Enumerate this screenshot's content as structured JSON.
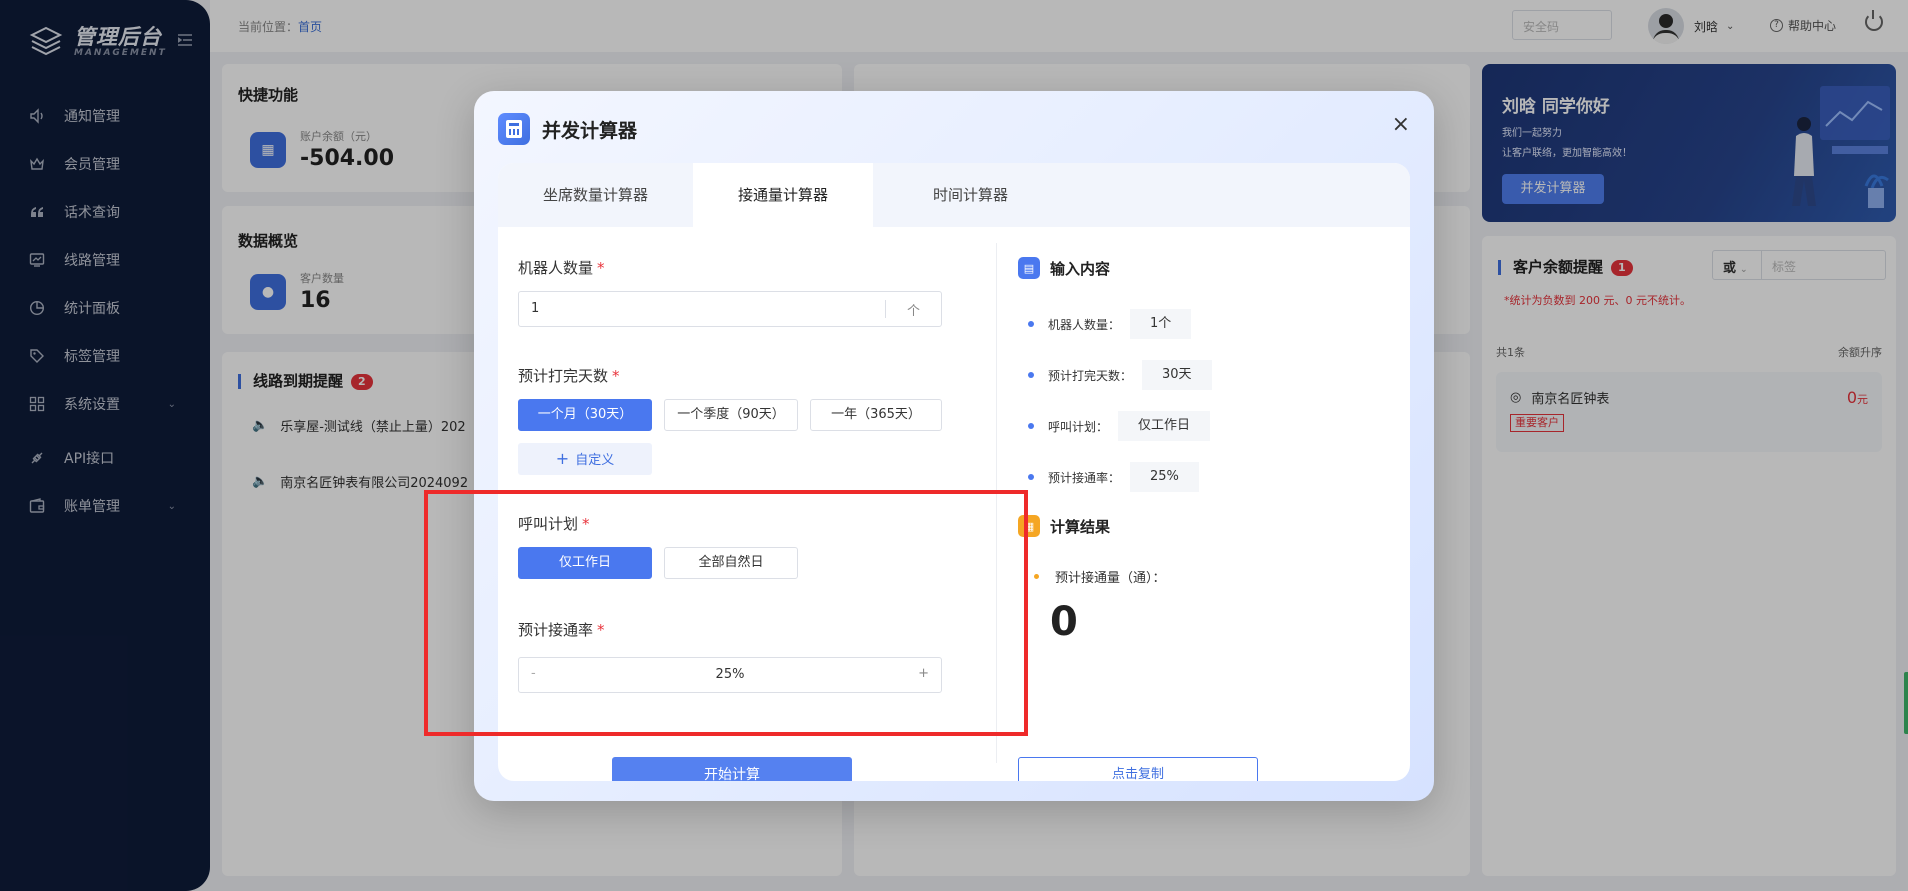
{
  "sidebar": {
    "logo_title": "管理后台",
    "logo_sub": "MANAGEMENT",
    "items": [
      {
        "label": "通知管理",
        "icon": "speaker-icon",
        "has_children": false
      },
      {
        "label": "会员管理",
        "icon": "crown-icon",
        "has_children": false
      },
      {
        "label": "话术查询",
        "icon": "quote-icon",
        "has_children": false
      },
      {
        "label": "线路管理",
        "icon": "monitor-icon",
        "has_children": false
      },
      {
        "label": "统计面板",
        "icon": "pie-chart-icon",
        "has_children": false
      },
      {
        "label": "标签管理",
        "icon": "tag-icon",
        "has_children": false
      },
      {
        "label": "系统设置",
        "icon": "grid-icon",
        "has_children": true
      },
      {
        "label": "API接口",
        "icon": "api-icon",
        "has_children": false
      },
      {
        "label": "账单管理",
        "icon": "wallet-icon",
        "has_children": true
      }
    ]
  },
  "topbar": {
    "breadcrumb_prefix": "当前位置：",
    "breadcrumb_link": "首页",
    "safe_code_placeholder": "安全码",
    "user_name": "刘晗",
    "help_label": "帮助中心"
  },
  "quick": {
    "title": "快捷功能",
    "balance_label": "账户余额（元）",
    "balance_value": "-504.00"
  },
  "overview": {
    "title": "数据概览",
    "customer_label": "客户数量",
    "customer_value": "16"
  },
  "line_expiry": {
    "title": "线路到期提醒",
    "count": "2",
    "rows": [
      "乐享屋-测试线（禁止上量）202",
      "南京名匠钟表有限公司2024092"
    ]
  },
  "banner": {
    "title": "刘晗 同学你好",
    "sub1": "我们一起努力",
    "sub2": "让客户联络，更加智能高效！",
    "button": "并发计算器"
  },
  "balance_alert": {
    "title": "客户余额提醒",
    "count": "1",
    "select_value": "或",
    "tag_placeholder": "标签",
    "note": "*统计为负数到 200 元、0 元不统计。",
    "total": "共1条",
    "sort": "余额升序",
    "items": [
      {
        "name": "南京名匠钟表",
        "tag": "重要客户",
        "amount": "0",
        "unit": "元"
      }
    ]
  },
  "modal": {
    "title": "并发计算器",
    "close": "×",
    "tabs": [
      {
        "label": "坐席数量计算器",
        "active": false
      },
      {
        "label": "接通量计算器",
        "active": true
      },
      {
        "label": "时间计算器",
        "active": false
      }
    ],
    "form": {
      "robots_label": "机器人数量",
      "robots_value": "1",
      "robots_unit": "个",
      "days_label": "预计打完天数",
      "days_options": [
        {
          "label": "一个月（30天）",
          "active": true
        },
        {
          "label": "一个季度（90天）",
          "active": false
        },
        {
          "label": "一年（365天）",
          "active": false
        }
      ],
      "custom_label": "自定义",
      "plan_label": "呼叫计划",
      "plan_options": [
        {
          "label": "仅工作日",
          "active": true
        },
        {
          "label": "全部自然日",
          "active": false
        }
      ],
      "rate_label": "预计接通率",
      "rate_value": "25%",
      "rate_minus": "-",
      "rate_plus": "+",
      "start_button": "开始计算",
      "required_mark": "*"
    },
    "input_section": {
      "title": "输入内容",
      "rows": [
        {
          "key": "机器人数量：",
          "value": "1个"
        },
        {
          "key": "预计打完天数：",
          "value": "30天"
        },
        {
          "key": "呼叫计划：",
          "value": "仅工作日"
        },
        {
          "key": "预计接通率：",
          "value": "25%"
        }
      ]
    },
    "result_section": {
      "title": "计算结果",
      "label": "预计接通量（通）：",
      "value": "0",
      "copy_button": "点击复制"
    }
  },
  "colors": {
    "primary": "#4a78ef",
    "sidebar_bg": "#0f1c3a",
    "highlight_box": "#ee2a2a",
    "danger": "#e8343c"
  }
}
